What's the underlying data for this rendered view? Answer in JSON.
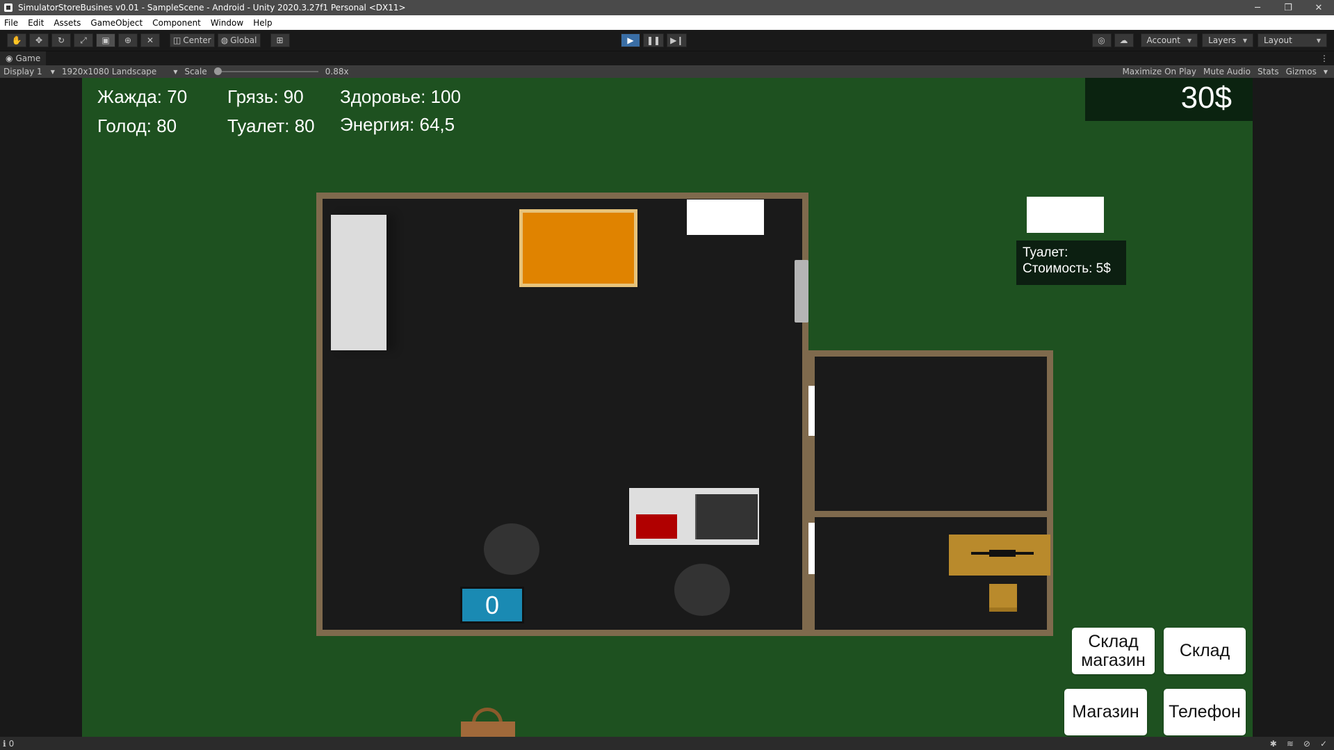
{
  "window": {
    "title": "SimulatorStoreBusines v0.01 - SampleScene - Android - Unity 2020.3.27f1 Personal <DX11>",
    "minimize": "─",
    "restore": "❐",
    "close": "✕"
  },
  "menu": [
    "File",
    "Edit",
    "Assets",
    "GameObject",
    "Component",
    "Window",
    "Help"
  ],
  "toolbar": {
    "pivot": "Center",
    "space": "Global",
    "account": "Account",
    "layers": "Layers",
    "layout": "Layout"
  },
  "panel": {
    "tab": "Game",
    "display": "Display 1",
    "resolution": "1920x1080 Landscape",
    "scale_label": "Scale",
    "scale_value": "0.88x",
    "scale_fraction": 0.0,
    "toggles": [
      "Maximize On Play",
      "Mute Audio",
      "Stats",
      "Gizmos"
    ]
  },
  "game": {
    "stats": {
      "thirst": "Жажда: 70",
      "hunger": "Голод: 80",
      "dirt": "Грязь: 90",
      "toilet": "Туалет: 80",
      "health": "Здоровье: 100",
      "energy": "Энергия: 64,5"
    },
    "money": "30$",
    "toilet_popup": {
      "line1": "Туалет:",
      "line2": "Стоимость: 5$"
    },
    "counter": "0",
    "buttons": {
      "warehouse_store_line1": "Склад",
      "warehouse_store_line2": "магазин",
      "warehouse": "Склад",
      "store": "Магазин",
      "phone": "Телефон"
    },
    "colors": {
      "background": "#1e5120",
      "wall": "#7f6a4d",
      "floor": "#1a1a1a",
      "rug": "#e08300",
      "counter": "#1a8ab3",
      "crate": "#b98a2c"
    }
  },
  "status": {
    "count": "0"
  }
}
